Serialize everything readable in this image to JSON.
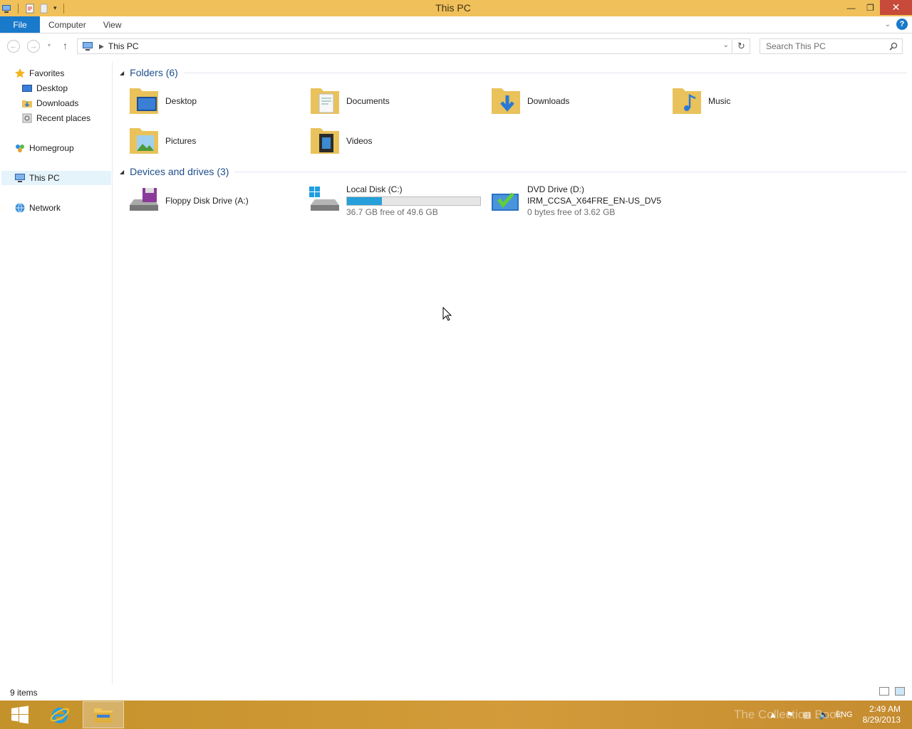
{
  "window": {
    "title": "This PC"
  },
  "ribbon": {
    "tabs": [
      "File",
      "Computer",
      "View"
    ]
  },
  "address": {
    "crumb": "This PC",
    "search_placeholder": "Search This PC"
  },
  "nav": {
    "favorites": "Favorites",
    "fav_items": [
      "Desktop",
      "Downloads",
      "Recent places"
    ],
    "homegroup": "Homegroup",
    "thispc": "This PC",
    "network": "Network"
  },
  "groups": {
    "folders_title": "Folders (6)",
    "folders": [
      "Desktop",
      "Documents",
      "Downloads",
      "Music",
      "Pictures",
      "Videos"
    ],
    "drives_title": "Devices and drives (3)",
    "floppy": {
      "label": "Floppy Disk Drive (A:)"
    },
    "local": {
      "label": "Local Disk (C:)",
      "free_text": "36.7 GB free of 49.6 GB",
      "used_fraction": 0.26
    },
    "dvd": {
      "label": "DVD Drive (D:)",
      "volume": "IRM_CCSA_X64FRE_EN-US_DV5",
      "free_text": "0 bytes free of 3.62 GB"
    }
  },
  "status": {
    "items": "9 items"
  },
  "taskbar": {
    "lang": "ENG",
    "time": "2:49 AM",
    "date": "8/29/2013",
    "watermark": "The Collection Book"
  },
  "colors": {
    "titlebar": "#f0c05a",
    "file_tab": "#1979ca",
    "bar_fill": "#26a0da",
    "group_title": "#1e4e8c"
  }
}
